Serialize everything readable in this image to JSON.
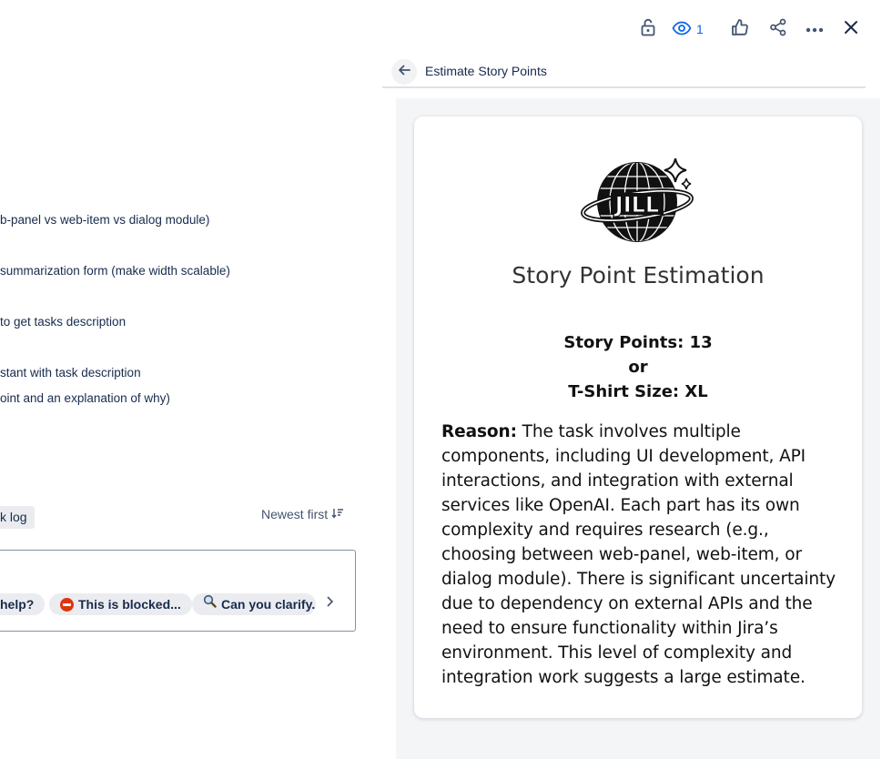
{
  "description": {
    "lines": [
      "b-panel vs web-item vs dialog module)",
      "summarization form (make width scalable)",
      "to get tasks description",
      "stant with task description",
      "oint and an explanation of why)"
    ]
  },
  "activity": {
    "worklog_tab": "k log",
    "sort_label": "Newest first",
    "quick_replies": [
      "help?",
      "This is blocked...",
      "Can you clarify..."
    ]
  },
  "toolbar": {
    "watch_count": "1"
  },
  "app": {
    "header_title": "Estimate Story Points",
    "logo_text": "JILL",
    "card": {
      "title": "Story Point Estimation",
      "points_line": "Story Points: 13",
      "or_line": "or",
      "size_line": "T-Shirt Size: XL",
      "reason_label": "Reason:",
      "reason_text": " The task involves multiple components, including UI development, API interactions, and integration with external services like OpenAI. Each part has its own complexity and requires research (e.g., choosing between web-panel, web-item, or dialog module). There is significant uncertainty due to dependency on external APIs and the need to ensure functionality within Jira’s environment. This level of complexity and integration work suggests a large estimate."
    }
  },
  "colors": {
    "accent": "#0c66e4",
    "blocked": "#de350b",
    "panel_bg": "#f4f5f7"
  }
}
